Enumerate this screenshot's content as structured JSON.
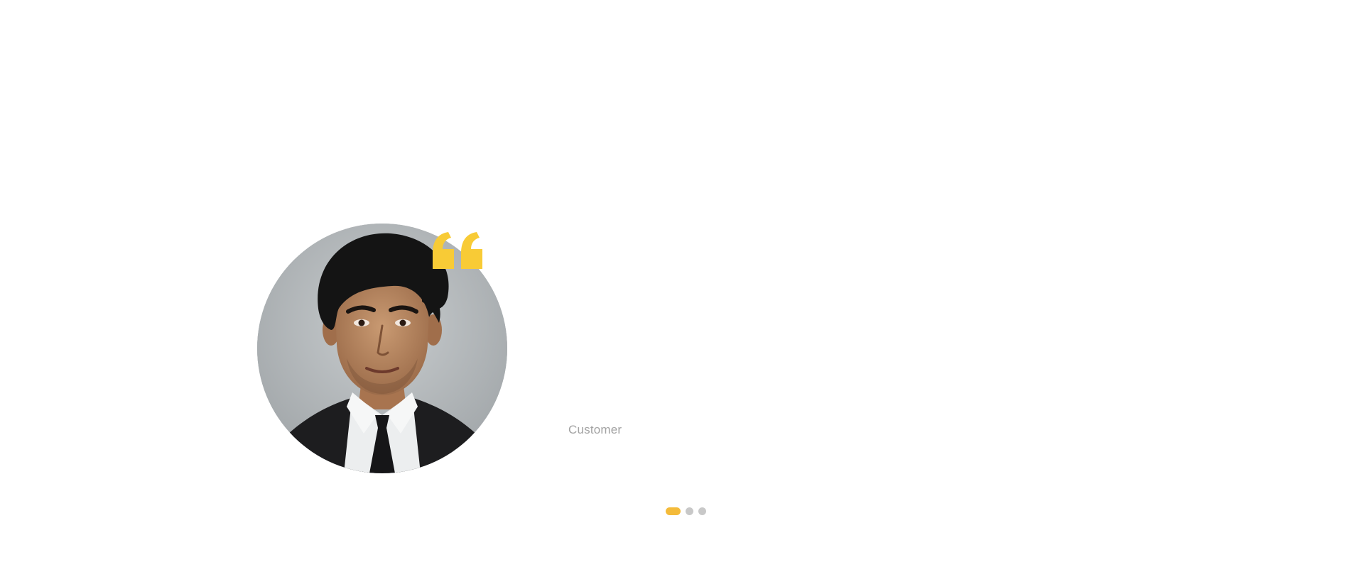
{
  "testimonial": {
    "author_role": "Customer",
    "quote_text": "",
    "avatar_icon": "person-photo-icon",
    "quote_icon": "quote-mark-icon"
  },
  "pagination": {
    "active_index": 0,
    "total": 3,
    "dots": [
      {
        "state": "active"
      },
      {
        "state": "inactive"
      },
      {
        "state": "inactive"
      }
    ]
  },
  "colors": {
    "accent": "#f4bb3a",
    "quote_mark": "#f8cb36",
    "dot_inactive": "#c8c8c8",
    "muted_text": "#a2a2a2",
    "background": "#ffffff"
  }
}
